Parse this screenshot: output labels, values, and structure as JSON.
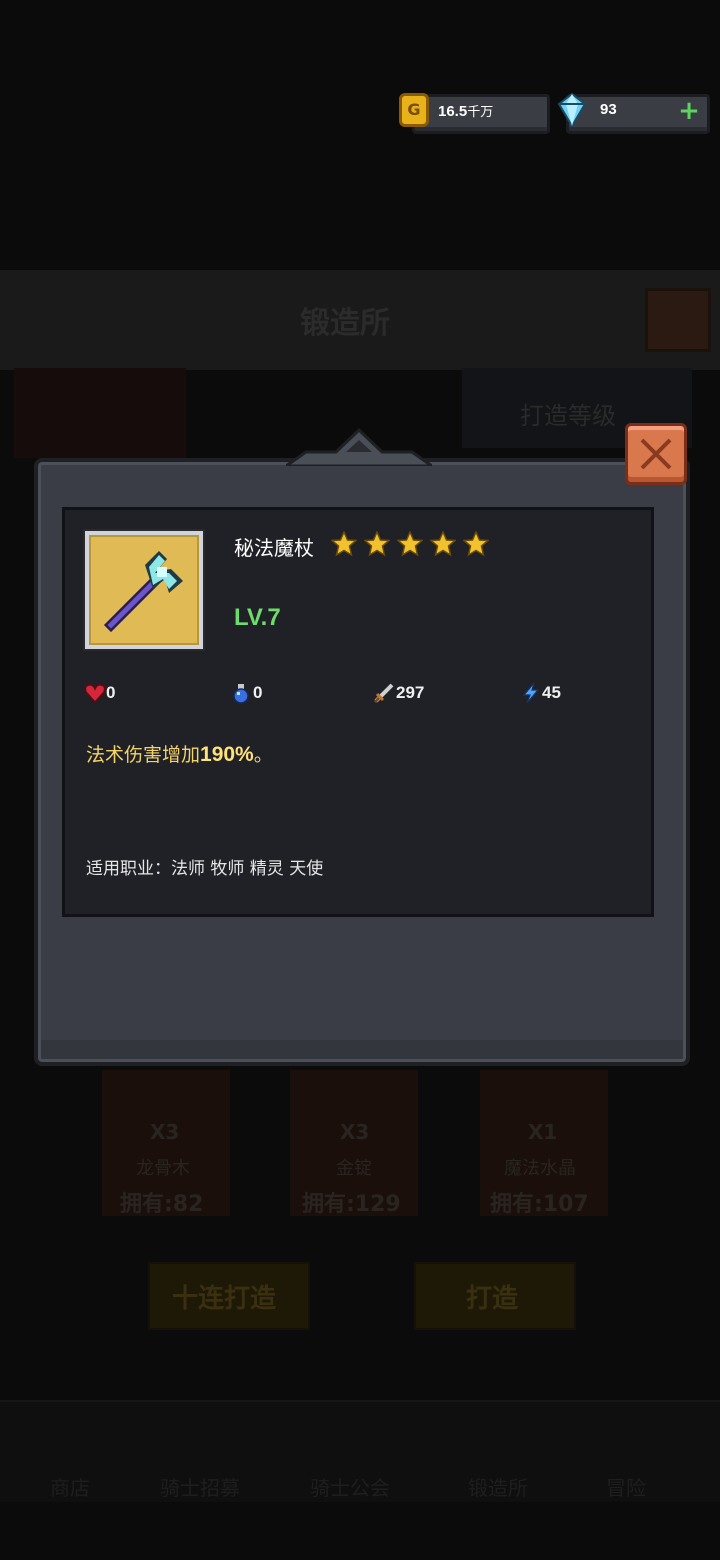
{
  "currency": {
    "gold_value": "16.5",
    "gold_unit": "千万",
    "gems_value": "93",
    "add_label": "+"
  },
  "background": {
    "title": "锻造所",
    "tab_label": "打造等级",
    "materials": [
      {
        "count": "X3",
        "name": "龙骨木",
        "owned": "拥有:82"
      },
      {
        "count": "X3",
        "name": "金锭",
        "owned": "拥有:129"
      },
      {
        "count": "X1",
        "name": "魔法水晶",
        "owned": "拥有:107"
      }
    ],
    "buttons": {
      "ten_forge": "十连打造",
      "forge": "打造"
    },
    "nav": [
      "商店",
      "骑士招募",
      "骑士公会",
      "锻造所",
      "冒险"
    ]
  },
  "item": {
    "icon": "arcane-staff-icon",
    "name": "秘法魔杖",
    "stars": 5,
    "level": "LV.7",
    "stats": {
      "hp": "0",
      "mana": "0",
      "attack": "297",
      "speed": "45"
    },
    "effect_prefix": "法术伤害增加",
    "effect_value": "190%",
    "effect_suffix": "。",
    "classes": "适用职业：法师 牧师 精灵 天使"
  },
  "colors": {
    "star": "#f2c12e",
    "level": "#6ddc6d",
    "effect": "#f3d36a",
    "close": "#d9774d",
    "item_bg": "#e0bb55"
  }
}
